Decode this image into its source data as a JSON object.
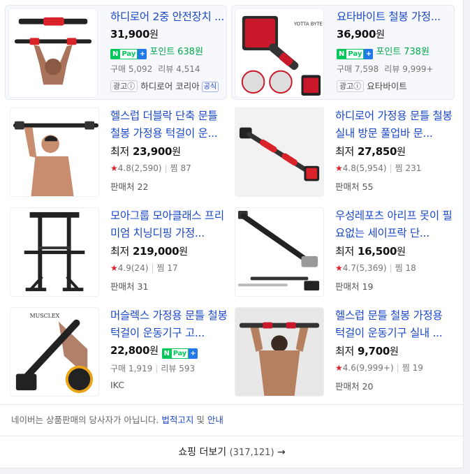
{
  "items": [
    {
      "title": "하디로어 2중 안전장치 ...",
      "price_value": "31,900",
      "won": "원",
      "npay": {
        "n": "N",
        "pay": "Pay",
        "plus": "+"
      },
      "point_label": "포인트",
      "point_value": "638원",
      "purchase_label": "구매",
      "purchase_count": "5,092",
      "review_label": "리뷰",
      "review_count": "4,514",
      "ad_label": "광고ⓘ",
      "seller": "하디로어 코리아",
      "official": "공식"
    },
    {
      "title": "요타바이트 철봉 가정...",
      "price_value": "36,900",
      "won": "원",
      "npay": {
        "n": "N",
        "pay": "Pay",
        "plus": "+"
      },
      "point_label": "포인트",
      "point_value": "738원",
      "purchase_label": "구매",
      "purchase_count": "7,598",
      "review_label": "리뷰",
      "review_count": "9,999+",
      "ad_label": "광고ⓘ",
      "seller": "요타바이트",
      "thumb_text": "YOTTA BYTE"
    },
    {
      "title": "헬스럽 더블락 단축 문틀 철봉 가정용 턱걸이 운...",
      "price_label": "최저",
      "price_value": "23,900",
      "won": "원",
      "rating": "4.8",
      "rating_count": "(2,590)",
      "zzim_label": "찜",
      "zzim": "87",
      "sellers_label": "판매처",
      "sellers": "22"
    },
    {
      "title": "하디로어 가정용 문틀 철봉 실내 방문 풀업바 문...",
      "price_label": "최저",
      "price_value": "27,850",
      "won": "원",
      "rating": "4.8",
      "rating_count": "(5,954)",
      "zzim_label": "찜",
      "zzim": "231",
      "sellers_label": "판매처",
      "sellers": "55"
    },
    {
      "title": "모아그룹 모아클래스 프리미엄 치닝디핑 가정...",
      "price_label": "최저",
      "price_value": "219,000",
      "won": "원",
      "rating": "4.9",
      "rating_count": "(24)",
      "zzim_label": "찜",
      "zzim": "17",
      "sellers_label": "판매처",
      "sellers": "31"
    },
    {
      "title": "우성레포츠 아리프 못이 필요없는 세이프락 단...",
      "price_label": "최저",
      "price_value": "16,500",
      "won": "원",
      "rating": "4.7",
      "rating_count": "(5,369)",
      "zzim_label": "찜",
      "zzim": "18",
      "sellers_label": "판매처",
      "sellers": "19"
    },
    {
      "title": "머슬렉스 가정용 문틀 철봉 턱걸이 운동기구 고...",
      "price_value": "22,800",
      "won": "원",
      "npay": {
        "n": "N",
        "pay": "Pay",
        "plus": "+"
      },
      "purchase_label": "구매",
      "purchase_count": "1,919",
      "review_label": "리뷰",
      "review_count": "593",
      "seller": "IKC",
      "thumb_text": "MUSCLEX"
    },
    {
      "title": "헬스럽 문틀 철봉 가정용 턱걸이 운동기구 실내 ...",
      "price_label": "최저",
      "price_value": "9,700",
      "won": "원",
      "rating": "4.6",
      "rating_count": "(9,999+)",
      "zzim_label": "찜",
      "zzim": "19",
      "sellers_label": "판매처",
      "sellers": "20"
    }
  ],
  "star": "★",
  "disclaimer": {
    "text": "네이버는 상품판매의 당사자가 아닙니다.",
    "link1": "법적고지",
    "and": "및",
    "link2": "안내"
  },
  "more": {
    "label": "쇼핑 더보기",
    "count": "(317,121)",
    "arrow": "→"
  },
  "colors": {
    "title": "#1a47c9",
    "star": "#e0212a",
    "npay": "#03c75a",
    "point": "#03a94e"
  }
}
